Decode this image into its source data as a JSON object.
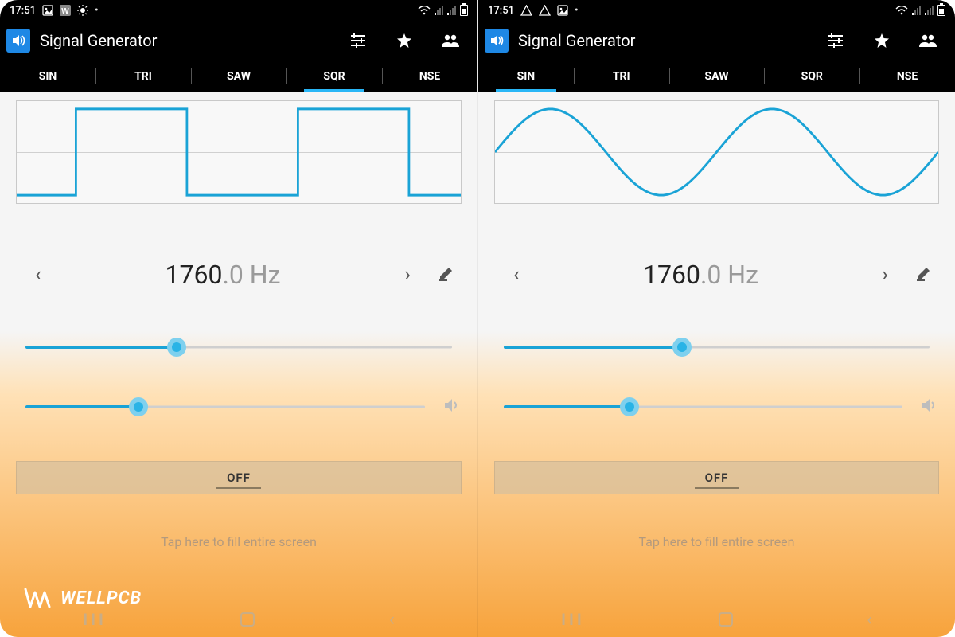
{
  "watermark": "WELLPCB",
  "panes": [
    {
      "status": {
        "time": "17:51",
        "left_icons": [
          "image-icon",
          "w-app-icon",
          "brightness-icon",
          "dot"
        ],
        "right_icons": [
          "wifi",
          "signal",
          "signal",
          "battery"
        ]
      },
      "app": {
        "title": "Signal Generator"
      },
      "tabs": {
        "labels": [
          "SIN",
          "TRI",
          "SAW",
          "SQR",
          "NSE"
        ],
        "active_index": 3
      },
      "wave": {
        "type": "square"
      },
      "freq": {
        "int": "1760",
        "dec": ".0",
        "unit": " Hz"
      },
      "slider1_pct": 34,
      "slider2_pct": 27,
      "power": "OFF",
      "hint": "Tap here to fill entire screen"
    },
    {
      "status": {
        "time": "17:51",
        "left_icons": [
          "triangle-icon",
          "triangle-icon",
          "image-icon",
          "dot"
        ],
        "right_icons": [
          "wifi",
          "signal",
          "signal",
          "battery"
        ]
      },
      "app": {
        "title": "Signal Generator"
      },
      "tabs": {
        "labels": [
          "SIN",
          "TRI",
          "SAW",
          "SQR",
          "NSE"
        ],
        "active_index": 0
      },
      "wave": {
        "type": "sine"
      },
      "freq": {
        "int": "1760",
        "dec": ".0",
        "unit": " Hz"
      },
      "slider1_pct": 40,
      "slider2_pct": 30,
      "power": "OFF",
      "hint": "Tap here to fill entire screen"
    }
  ],
  "chart_data": [
    {
      "type": "line",
      "title": "Square wave preview",
      "series": [
        {
          "name": "SQR",
          "values_desc": "2 periods of 50% duty-cycle square wave between -1 and 1"
        }
      ],
      "ylim": [
        -1,
        1
      ]
    },
    {
      "type": "line",
      "title": "Sine wave preview",
      "series": [
        {
          "name": "SIN",
          "values_desc": "2 periods of sine wave, amplitude 1"
        }
      ],
      "ylim": [
        -1,
        1
      ]
    }
  ]
}
